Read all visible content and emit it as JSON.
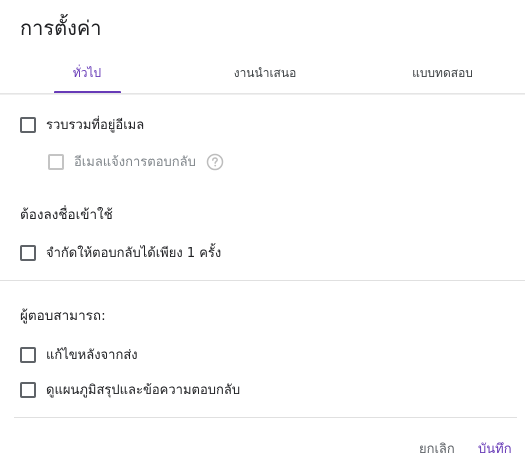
{
  "dialog": {
    "title": "การตั้งค่า"
  },
  "tabs": [
    {
      "label": "ทั่วไป",
      "active": true
    },
    {
      "label": "งานนำเสนอ",
      "active": false
    },
    {
      "label": "แบบทดสอบ",
      "active": false
    }
  ],
  "general": {
    "collect_email": {
      "label": "รวบรวมที่อยู่อีเมล",
      "checked": false
    },
    "response_receipts": {
      "label": "อีเมลแจ้งการตอบกลับ",
      "checked": false,
      "disabled": true
    },
    "requires_signin_title": "ต้องลงชื่อเข้าใช้",
    "limit_one_response": {
      "label": "จำกัดให้ตอบกลับได้เพียง 1 ครั้ง",
      "checked": false
    },
    "respondents_can_title": "ผู้ตอบสามารถ:",
    "edit_after_submit": {
      "label": "แก้ไขหลังจากส่ง",
      "checked": false
    },
    "see_summary": {
      "label": "ดูแผนภูมิสรุปและข้อความตอบกลับ",
      "checked": false
    }
  },
  "footer": {
    "cancel_label": "ยกเลิก",
    "save_label": "บันทึก"
  },
  "colors": {
    "accent": "#673ab7",
    "text": "#202124",
    "muted": "#80868b"
  },
  "icons": {
    "help": "help-circle-icon"
  }
}
